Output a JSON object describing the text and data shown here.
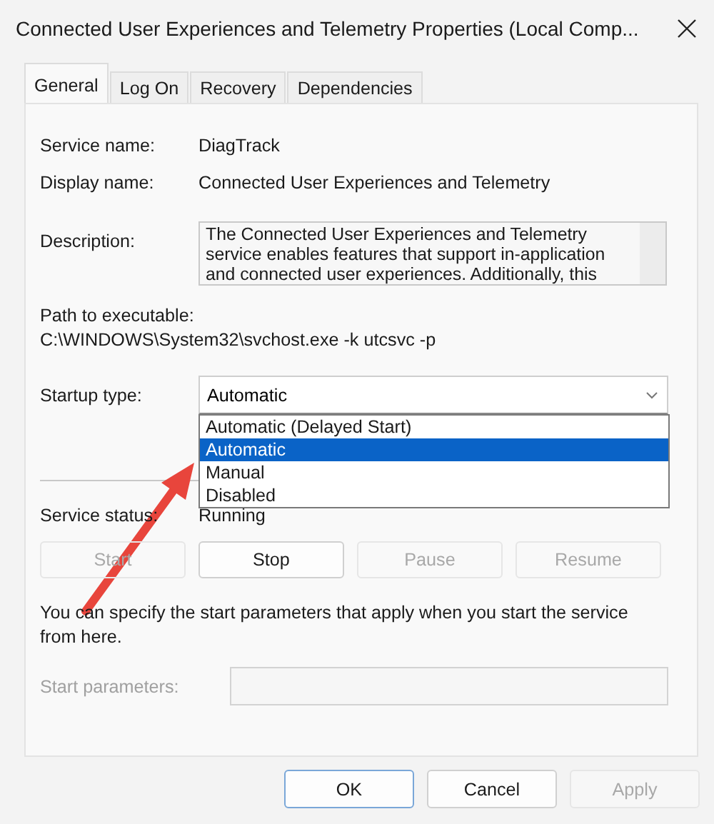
{
  "window": {
    "title": "Connected User Experiences and Telemetry Properties (Local Comp..."
  },
  "tabs": [
    {
      "label": "General",
      "selected": true
    },
    {
      "label": "Log On",
      "selected": false
    },
    {
      "label": "Recovery",
      "selected": false
    },
    {
      "label": "Dependencies",
      "selected": false
    }
  ],
  "fields": [
    {
      "label": "Service name:",
      "value": "DiagTrack"
    },
    {
      "label": "Display name:",
      "value": "Connected User Experiences and Telemetry"
    }
  ],
  "description": {
    "label": "Description:",
    "text": "The Connected User Experiences and Telemetry service enables features that support in-application and connected user experiences. Additionally, this"
  },
  "path": {
    "label": "Path to executable:",
    "value": "C:\\WINDOWS\\System32\\svchost.exe -k utcsvc -p"
  },
  "startup": {
    "label": "Startup type:",
    "value": "Automatic",
    "expanded": true,
    "options": [
      {
        "label": "Automatic (Delayed Start)",
        "selected": false
      },
      {
        "label": "Automatic",
        "selected": true
      },
      {
        "label": "Manual",
        "selected": false
      },
      {
        "label": "Disabled",
        "selected": false
      }
    ]
  },
  "status": {
    "label": "Service status:",
    "value": "Running"
  },
  "service_buttons": [
    {
      "label": "Start",
      "disabled": true
    },
    {
      "label": "Stop",
      "disabled": false
    },
    {
      "label": "Pause",
      "disabled": true
    },
    {
      "label": "Resume",
      "disabled": true
    }
  ],
  "hint": "You can specify the start parameters that apply when you start the service from here.",
  "start_parameters": {
    "label": "Start parameters:",
    "disabled": true
  },
  "buttons": [
    {
      "label": "OK",
      "default": true,
      "disabled": false
    },
    {
      "label": "Cancel",
      "default": false,
      "disabled": false
    },
    {
      "label": "Apply",
      "default": false,
      "disabled": true
    }
  ],
  "annotation": {
    "kind": "arrow"
  }
}
